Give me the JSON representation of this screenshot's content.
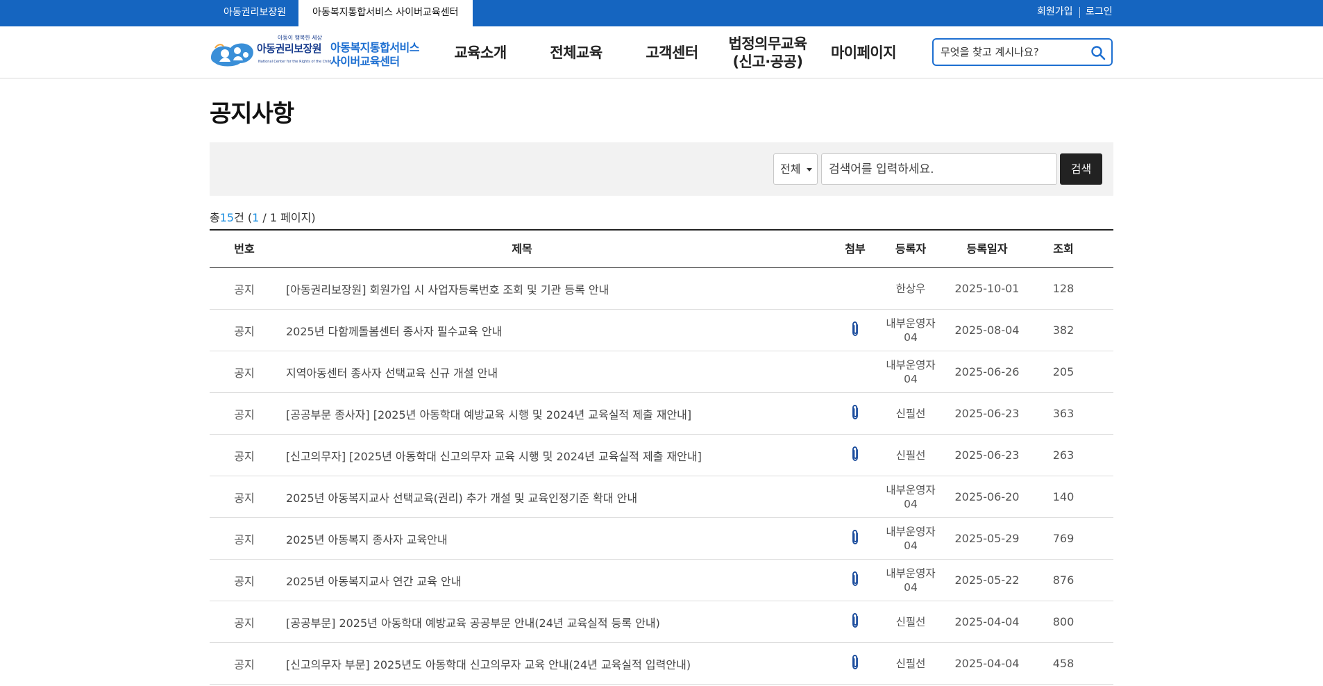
{
  "topbar": {
    "tabs": [
      {
        "label": "아동권리보장원"
      },
      {
        "label": "아동복지통합서비스 사이버교육센터"
      }
    ],
    "links": {
      "signup": "회원가입",
      "login": "로그인"
    },
    "colors": {
      "bar": "#1565c0"
    }
  },
  "header": {
    "logo": {
      "slogan": "아동이 행복한 세상",
      "org": "아동권리보장원",
      "org_en": "National Center for the Rights of the Child",
      "service_line1": "아동복지통합서비스",
      "service_line2": "사이버교육센터"
    },
    "nav": [
      {
        "label": "교육소개"
      },
      {
        "label": "전체교육"
      },
      {
        "label": "고객센터"
      },
      {
        "label_line1": "법정의무교육",
        "label_line2": "(신고·공공)"
      },
      {
        "label": "마이페이지"
      }
    ],
    "search": {
      "placeholder": "무엇을 찾고 계시나요?",
      "icon": "search-icon"
    }
  },
  "page": {
    "title": "공지사항"
  },
  "search_form": {
    "select_value": "전체",
    "keyword_placeholder": "검색어를 입력하세요.",
    "button_label": "검색"
  },
  "summary": {
    "prefix": "총",
    "total": "15",
    "unit": "건 (",
    "current_page": "1",
    "suffix": " / 1 페이지)"
  },
  "table": {
    "headers": {
      "no": "번호",
      "title": "제목",
      "file": "첨부",
      "writer": "등록자",
      "date": "등록일자",
      "views": "조회"
    },
    "rows": [
      {
        "no": "공지",
        "title": "[아동권리보장원] 회원가입 시 사업자등록번호 조회 및 기관 등록 안내",
        "attach": false,
        "writer_l1": "한상우",
        "writer_l2": "",
        "date": "2025-10-01",
        "views": "128"
      },
      {
        "no": "공지",
        "title": "2025년 다함께돌봄센터 종사자 필수교육 안내",
        "attach": true,
        "writer_l1": "내부운영자",
        "writer_l2": "04",
        "date": "2025-08-04",
        "views": "382"
      },
      {
        "no": "공지",
        "title": "지역아동센터 종사자 선택교육 신규 개설 안내",
        "attach": false,
        "writer_l1": "내부운영자",
        "writer_l2": "04",
        "date": "2025-06-26",
        "views": "205"
      },
      {
        "no": "공지",
        "title": "[공공부문 종사자] [2025년 아동학대 예방교육 시행 및 2024년 교육실적 제출 재안내]",
        "attach": true,
        "writer_l1": "신필선",
        "writer_l2": "",
        "date": "2025-06-23",
        "views": "363"
      },
      {
        "no": "공지",
        "title": "[신고의무자] [2025년 아동학대 신고의무자 교육 시행 및 2024년 교육실적 제출 재안내]",
        "attach": true,
        "writer_l1": "신필선",
        "writer_l2": "",
        "date": "2025-06-23",
        "views": "263"
      },
      {
        "no": "공지",
        "title": "2025년 아동복지교사 선택교육(권리) 추가 개설 및 교육인정기준 확대 안내",
        "attach": false,
        "writer_l1": "내부운영자",
        "writer_l2": "04",
        "date": "2025-06-20",
        "views": "140"
      },
      {
        "no": "공지",
        "title": "2025년 아동복지 종사자 교육안내",
        "attach": true,
        "writer_l1": "내부운영자",
        "writer_l2": "04",
        "date": "2025-05-29",
        "views": "769"
      },
      {
        "no": "공지",
        "title": "2025년 아동복지교사 연간 교육 안내",
        "attach": true,
        "writer_l1": "내부운영자",
        "writer_l2": "04",
        "date": "2025-05-22",
        "views": "876"
      },
      {
        "no": "공지",
        "title": "[공공부문] 2025년 아동학대 예방교육 공공부문 안내(24년 교육실적 등록 안내)",
        "attach": true,
        "writer_l1": "신필선",
        "writer_l2": "",
        "date": "2025-04-04",
        "views": "800"
      },
      {
        "no": "공지",
        "title": "[신고의무자 부문] 2025년도 아동학대 신고의무자 교육 안내(24년 교육실적 입력안내)",
        "attach": true,
        "writer_l1": "신필선",
        "writer_l2": "",
        "date": "2025-04-04",
        "views": "458"
      }
    ]
  }
}
